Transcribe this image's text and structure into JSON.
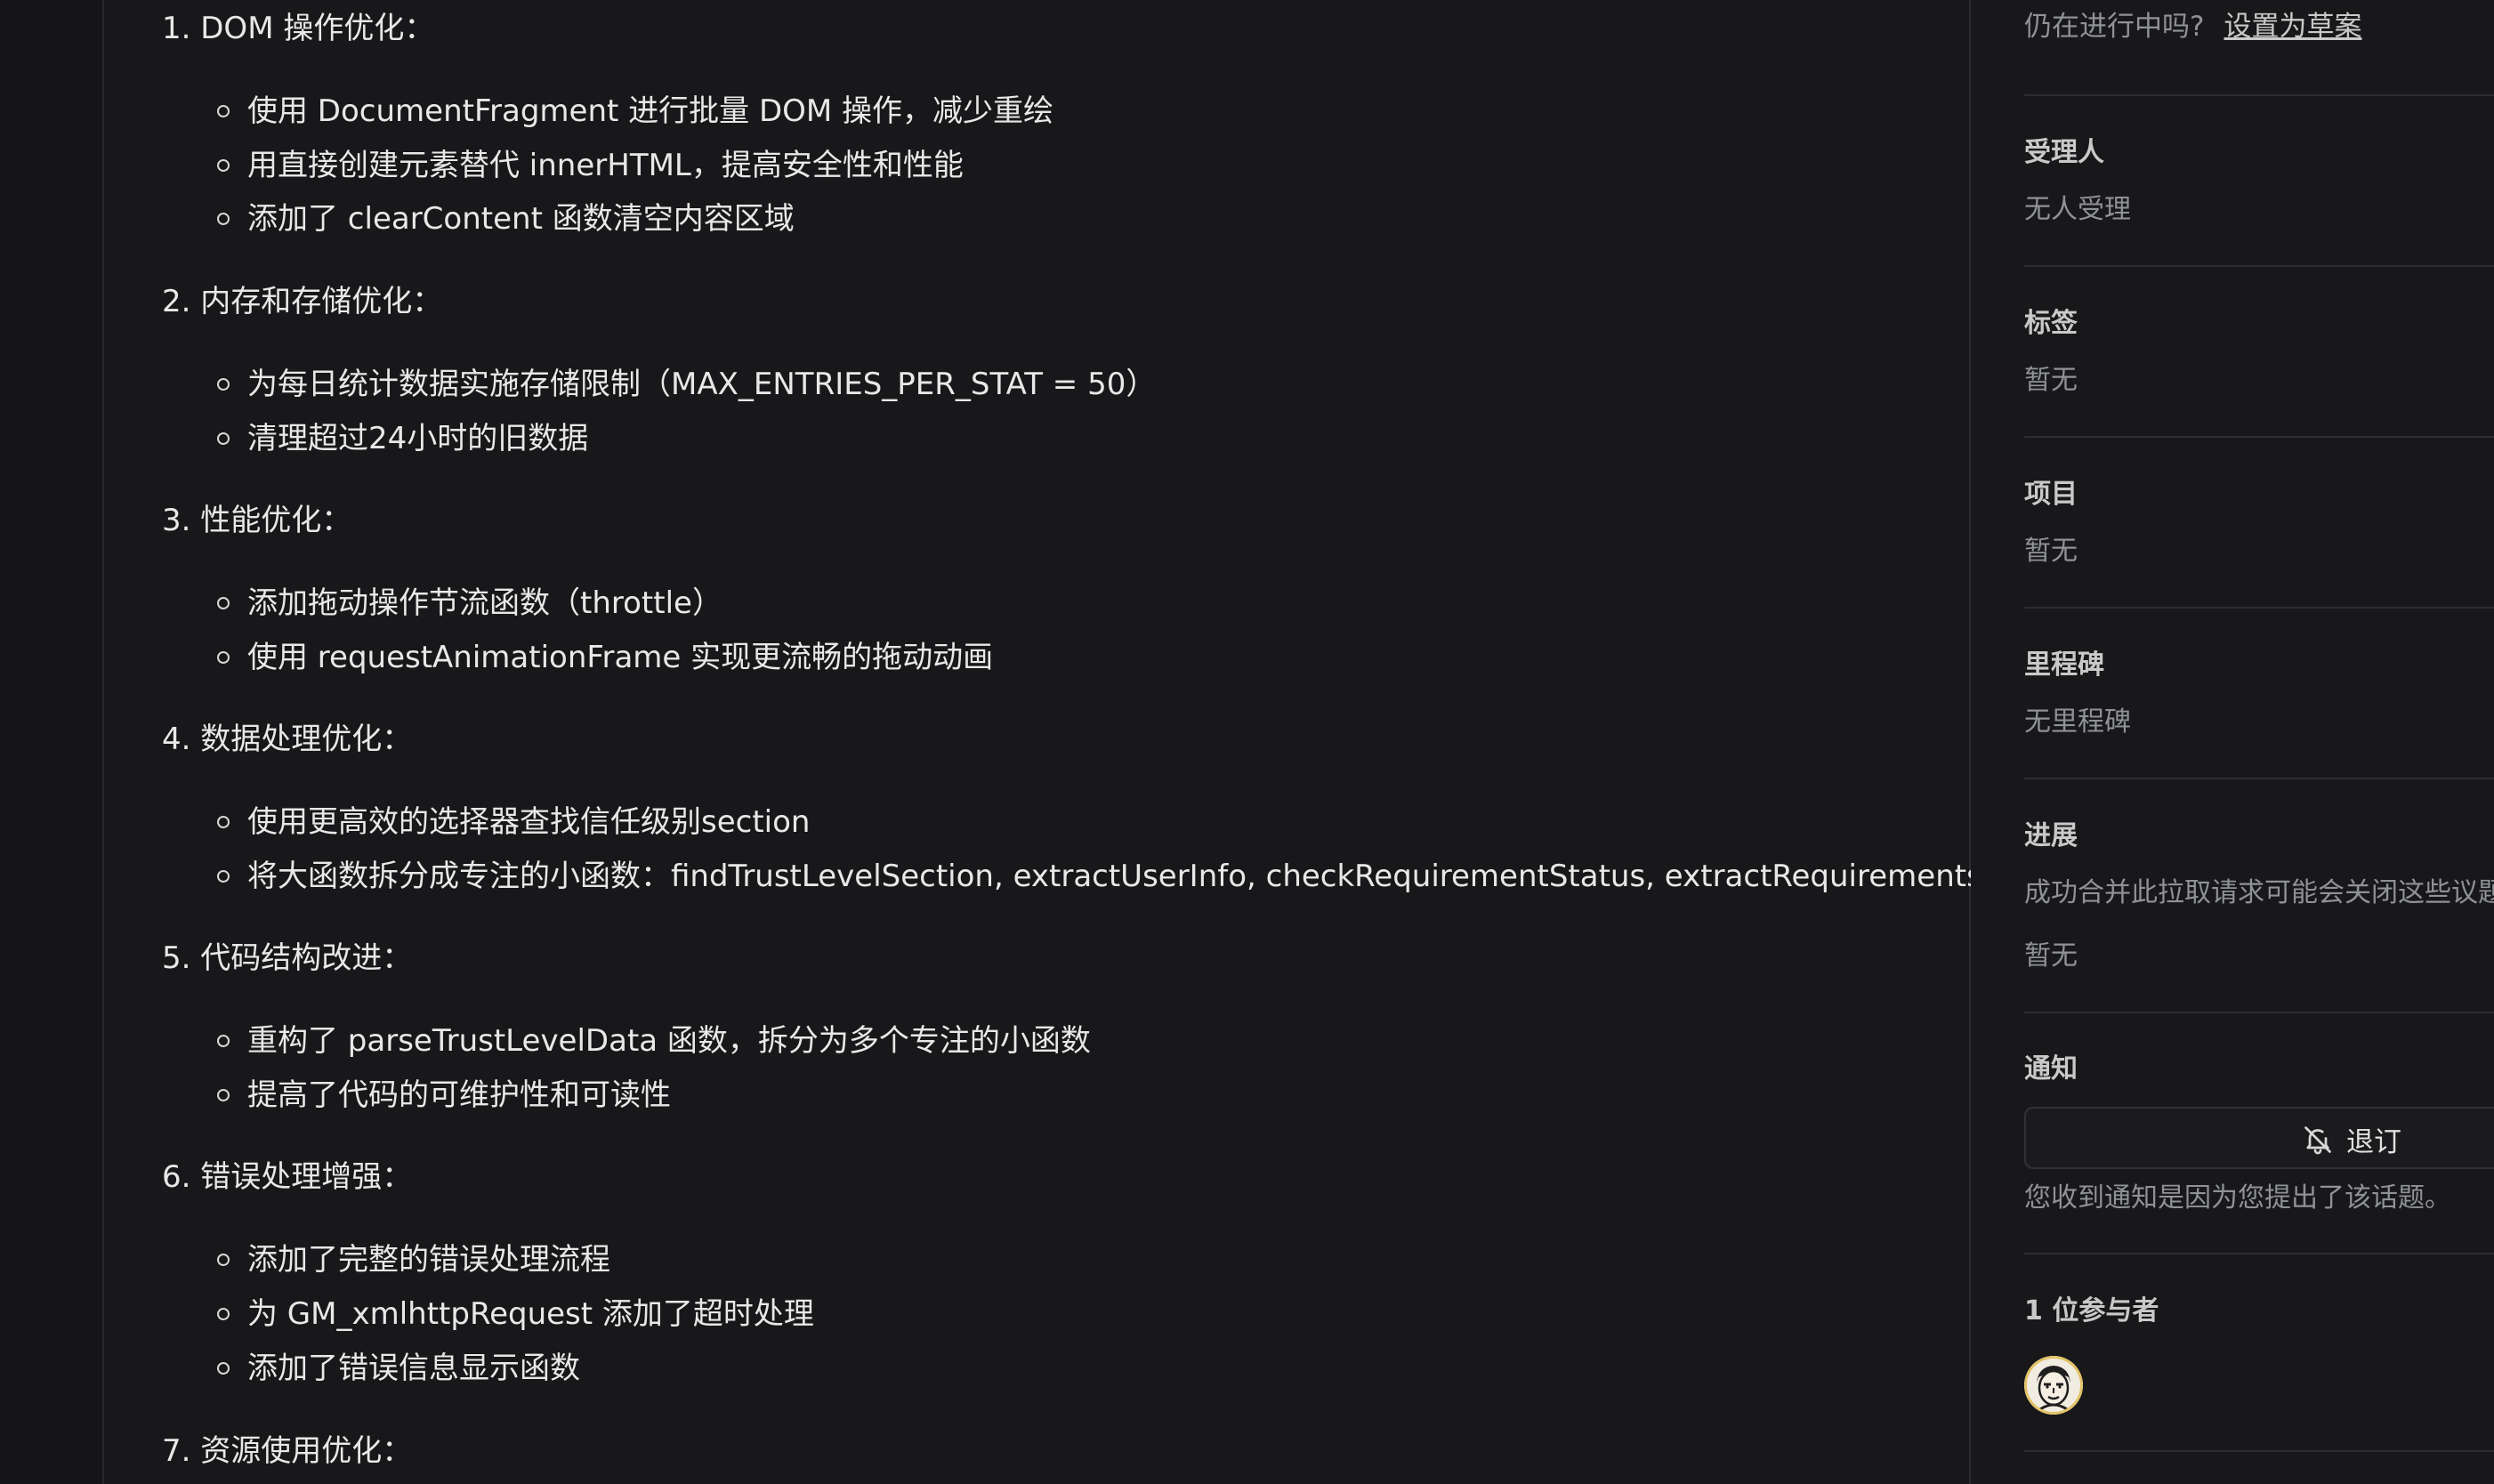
{
  "content": {
    "sections": [
      {
        "title": "1. DOM 操作优化：",
        "items": [
          "使用 DocumentFragment 进行批量 DOM 操作，减少重绘",
          "用直接创建元素替代 innerHTML，提高安全性和性能",
          "添加了 clearContent 函数清空内容区域"
        ]
      },
      {
        "title": "2. 内存和存储优化：",
        "items": [
          "为每日统计数据实施存储限制（MAX_ENTRIES_PER_STAT = 50）",
          "清理超过24小时的旧数据"
        ]
      },
      {
        "title": "3. 性能优化：",
        "items": [
          "添加拖动操作节流函数（throttle）",
          "使用 requestAnimationFrame 实现更流畅的拖动动画"
        ]
      },
      {
        "title": "4. 数据处理优化：",
        "items": [
          "使用更高效的选择器查找信任级别section",
          "将大函数拆分成专注的小函数：findTrustLevelSection, extractUserInfo, checkRequirementStatus, extractRequirements 等"
        ]
      },
      {
        "title": "5. 代码结构改进：",
        "items": [
          "重构了 parseTrustLevelData 函数，拆分为多个专注的小函数",
          "提高了代码的可维护性和可读性"
        ]
      },
      {
        "title": "6. 错误处理增强：",
        "items": [
          "添加了完整的错误处理流程",
          "为 GM_xmlhttpRequest 添加了超时处理",
          "添加了错误信息显示函数"
        ]
      },
      {
        "title": "7. 资源使用优化：",
        "items": []
      }
    ]
  },
  "sidebar": {
    "draft_question": "仍在进行中吗?",
    "draft_link": "设置为草案",
    "assignee": {
      "label": "受理人",
      "value": "无人受理"
    },
    "labels": {
      "label": "标签",
      "value": "暂无"
    },
    "projects": {
      "label": "项目",
      "value": "暂无"
    },
    "milestone": {
      "label": "里程碑",
      "value": "无里程碑"
    },
    "development": {
      "label": "进展",
      "note": "成功合并此拉取请求可能会关闭这些议题",
      "value": "暂无"
    },
    "notifications": {
      "label": "通知",
      "button": "退订",
      "reason": "您收到通知是因为您提出了该话题。"
    },
    "participants": {
      "label": "1 位参与者"
    }
  }
}
